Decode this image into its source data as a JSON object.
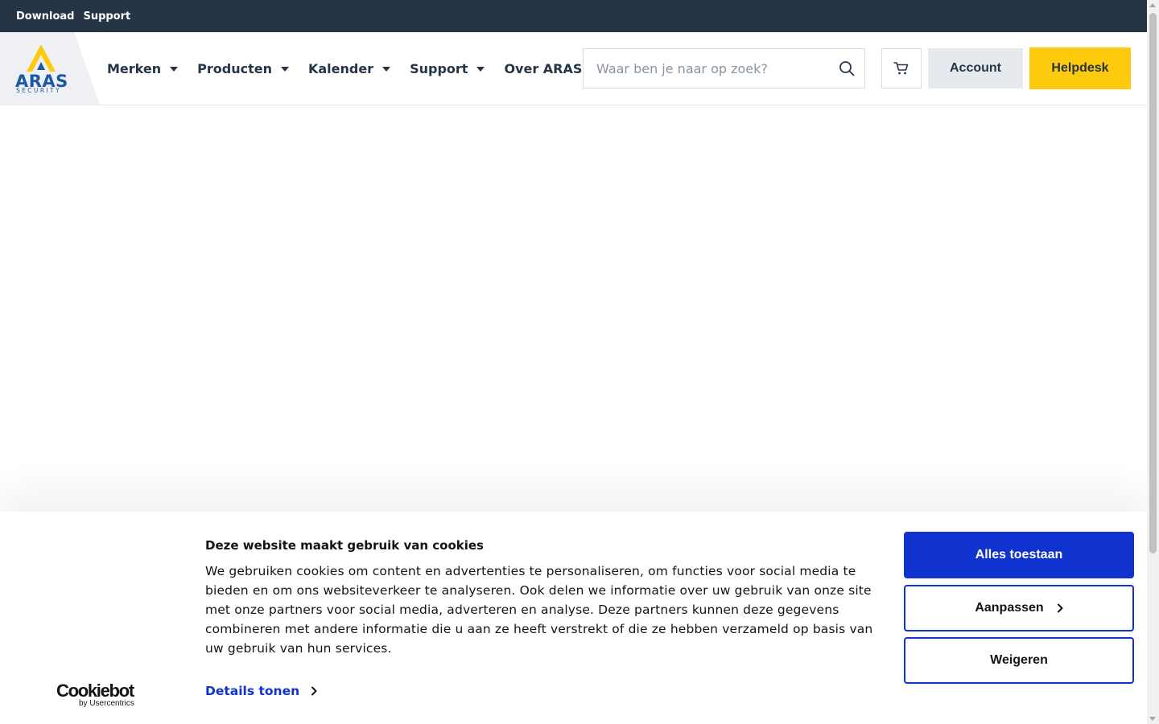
{
  "topbar": {
    "links": [
      "Download",
      "Support"
    ]
  },
  "header": {
    "logo": {
      "name": "ARAS",
      "sub": "SECURITY"
    },
    "nav": [
      "Merken",
      "Producten",
      "Kalender",
      "Support",
      "Over ARAS"
    ],
    "search": {
      "placeholder": "Waar ben je naar op zoek?",
      "value": ""
    },
    "account_label": "Account",
    "helpdesk_label": "Helpdesk"
  },
  "cookie_banner": {
    "title": "Deze website maakt gebruik van cookies",
    "text": "We gebruiken cookies om content en advertenties te personaliseren, om functies voor social media te bieden en om ons websiteverkeer te analyseren. Ook delen we informatie over uw gebruik van onze site met onze partners voor social media, adverteren en analyse. Deze partners kunnen deze gegevens combineren met andere informatie die u aan ze heeft verstrekt of die ze hebben verzameld op basis van uw gebruik van hun services.",
    "details_label": "Details tonen",
    "brand": {
      "name": "Cookiebot",
      "by": "by Usercentrics"
    },
    "allow_all_label": "Alles toestaan",
    "customize_label": "Aanpassen",
    "deny_label": "Weigeren"
  },
  "colors": {
    "topbar_bg": "#253545",
    "brand_blue": "#1d57a8",
    "brand_yellow": "#fdca0e",
    "cookie_accent": "#1032cf"
  }
}
